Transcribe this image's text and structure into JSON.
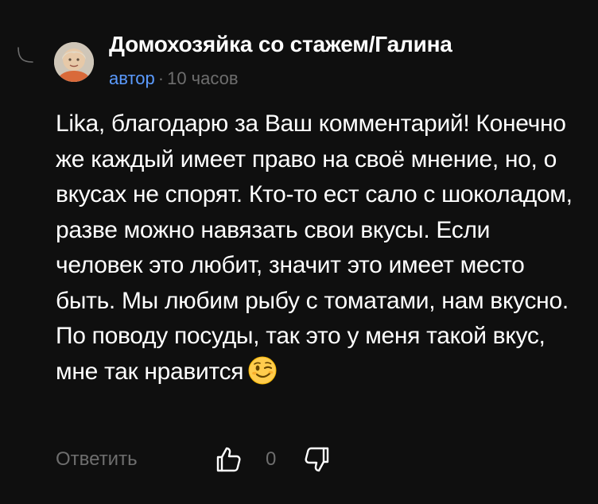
{
  "comment": {
    "author_name": "Домохозяйка со стажем/Галина",
    "author_badge": "автор",
    "meta_separator": "·",
    "timestamp": "10 часов",
    "text": "Lika, благодарю за Ваш комментарий! Конечно же каждый имеет право на своё мнение, но, о вкусах не спорят. Кто-то ест сало с шоколадом, разве можно навязать свои вкусы. Если человек это любит, значит это имеет место быть. Мы любим рыбу с томатами, нам вкусно. По поводу посуды, так это у меня такой вкус, мне так нравится",
    "emoji": "winking-face"
  },
  "actions": {
    "reply_label": "Ответить",
    "like_count": "0"
  },
  "colors": {
    "background": "#0f0f0f",
    "text": "#ffffff",
    "muted": "#6e6e6e",
    "accent": "#5b9bff"
  }
}
